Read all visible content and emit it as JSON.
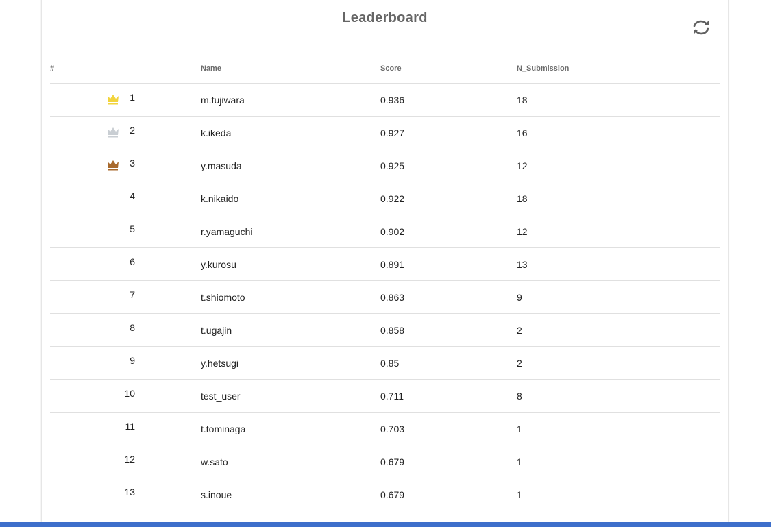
{
  "leaderboard": {
    "title": "Leaderboard",
    "refresh_icon": "refresh-icon",
    "columns": {
      "rank": "#",
      "name": "Name",
      "score": "Score",
      "submissions": "N_Submission"
    },
    "rows": [
      {
        "rank": "1",
        "name": "m.fujiwara",
        "score": "0.936",
        "submissions": "18",
        "crown": "gold"
      },
      {
        "rank": "2",
        "name": "k.ikeda",
        "score": "0.927",
        "submissions": "16",
        "crown": "silver"
      },
      {
        "rank": "3",
        "name": "y.masuda",
        "score": "0.925",
        "submissions": "12",
        "crown": "bronze"
      },
      {
        "rank": "4",
        "name": "k.nikaido",
        "score": "0.922",
        "submissions": "18"
      },
      {
        "rank": "5",
        "name": "r.yamaguchi",
        "score": "0.902",
        "submissions": "12"
      },
      {
        "rank": "6",
        "name": "y.kurosu",
        "score": "0.891",
        "submissions": "13"
      },
      {
        "rank": "7",
        "name": "t.shiomoto",
        "score": "0.863",
        "submissions": "9"
      },
      {
        "rank": "8",
        "name": "t.ugajin",
        "score": "0.858",
        "submissions": "2"
      },
      {
        "rank": "9",
        "name": "y.hetsugi",
        "score": "0.85",
        "submissions": "2"
      },
      {
        "rank": "10",
        "name": "test_user",
        "score": "0.711",
        "submissions": "8"
      },
      {
        "rank": "11",
        "name": "t.tominaga",
        "score": "0.703",
        "submissions": "1"
      },
      {
        "rank": "12",
        "name": "w.sato",
        "score": "0.679",
        "submissions": "1"
      },
      {
        "rank": "13",
        "name": "s.inoue",
        "score": "0.679",
        "submissions": "1"
      }
    ]
  },
  "colors": {
    "gold": "#f2d43d",
    "silver": "#c9ced3",
    "bronze": "#a8692c",
    "bottom_bar": "#3d6fcb",
    "icon": "#616161"
  }
}
